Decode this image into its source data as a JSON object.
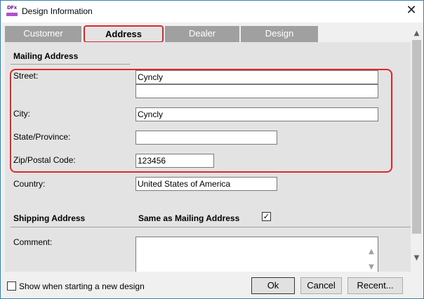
{
  "window": {
    "title": "Design Information",
    "app_icon_text": "DFx",
    "close_glyph": "✕"
  },
  "tabs": [
    {
      "label": "Customer",
      "active": false
    },
    {
      "label": "Address",
      "active": true
    },
    {
      "label": "Dealer",
      "active": false
    },
    {
      "label": "Design",
      "active": false
    }
  ],
  "mailing": {
    "section_title": "Mailing Address",
    "street_label": "Street:",
    "street_line1": "Cyncly",
    "street_line2": "",
    "city_label": "City:",
    "city_value": "Cyncly",
    "state_label": "State/Province:",
    "state_value": "",
    "zip_label": "Zip/Postal Code:",
    "zip_value": "123456",
    "country_label": "Country:",
    "country_value": "United States of America"
  },
  "shipping": {
    "section_title": "Shipping Address",
    "same_as_label": "Same as Mailing Address",
    "same_as_checked": true,
    "check_glyph": "✓"
  },
  "comment": {
    "label": "Comment:",
    "value": "",
    "scroll_up_glyph": "▲",
    "scroll_down_glyph": "▼"
  },
  "scrollbar": {
    "up_glyph": "▲",
    "down_glyph": "▼"
  },
  "footer": {
    "show_on_start_label": "Show when starting a new design",
    "show_on_start_checked": false,
    "ok_label": "Ok",
    "cancel_label": "Cancel",
    "recent_label": "Recent..."
  },
  "colors": {
    "highlight": "#e0262b",
    "tab_inactive": "#a0a0a0",
    "panel_bg": "#e3e3e3",
    "window_border": "#3c7fb1"
  }
}
